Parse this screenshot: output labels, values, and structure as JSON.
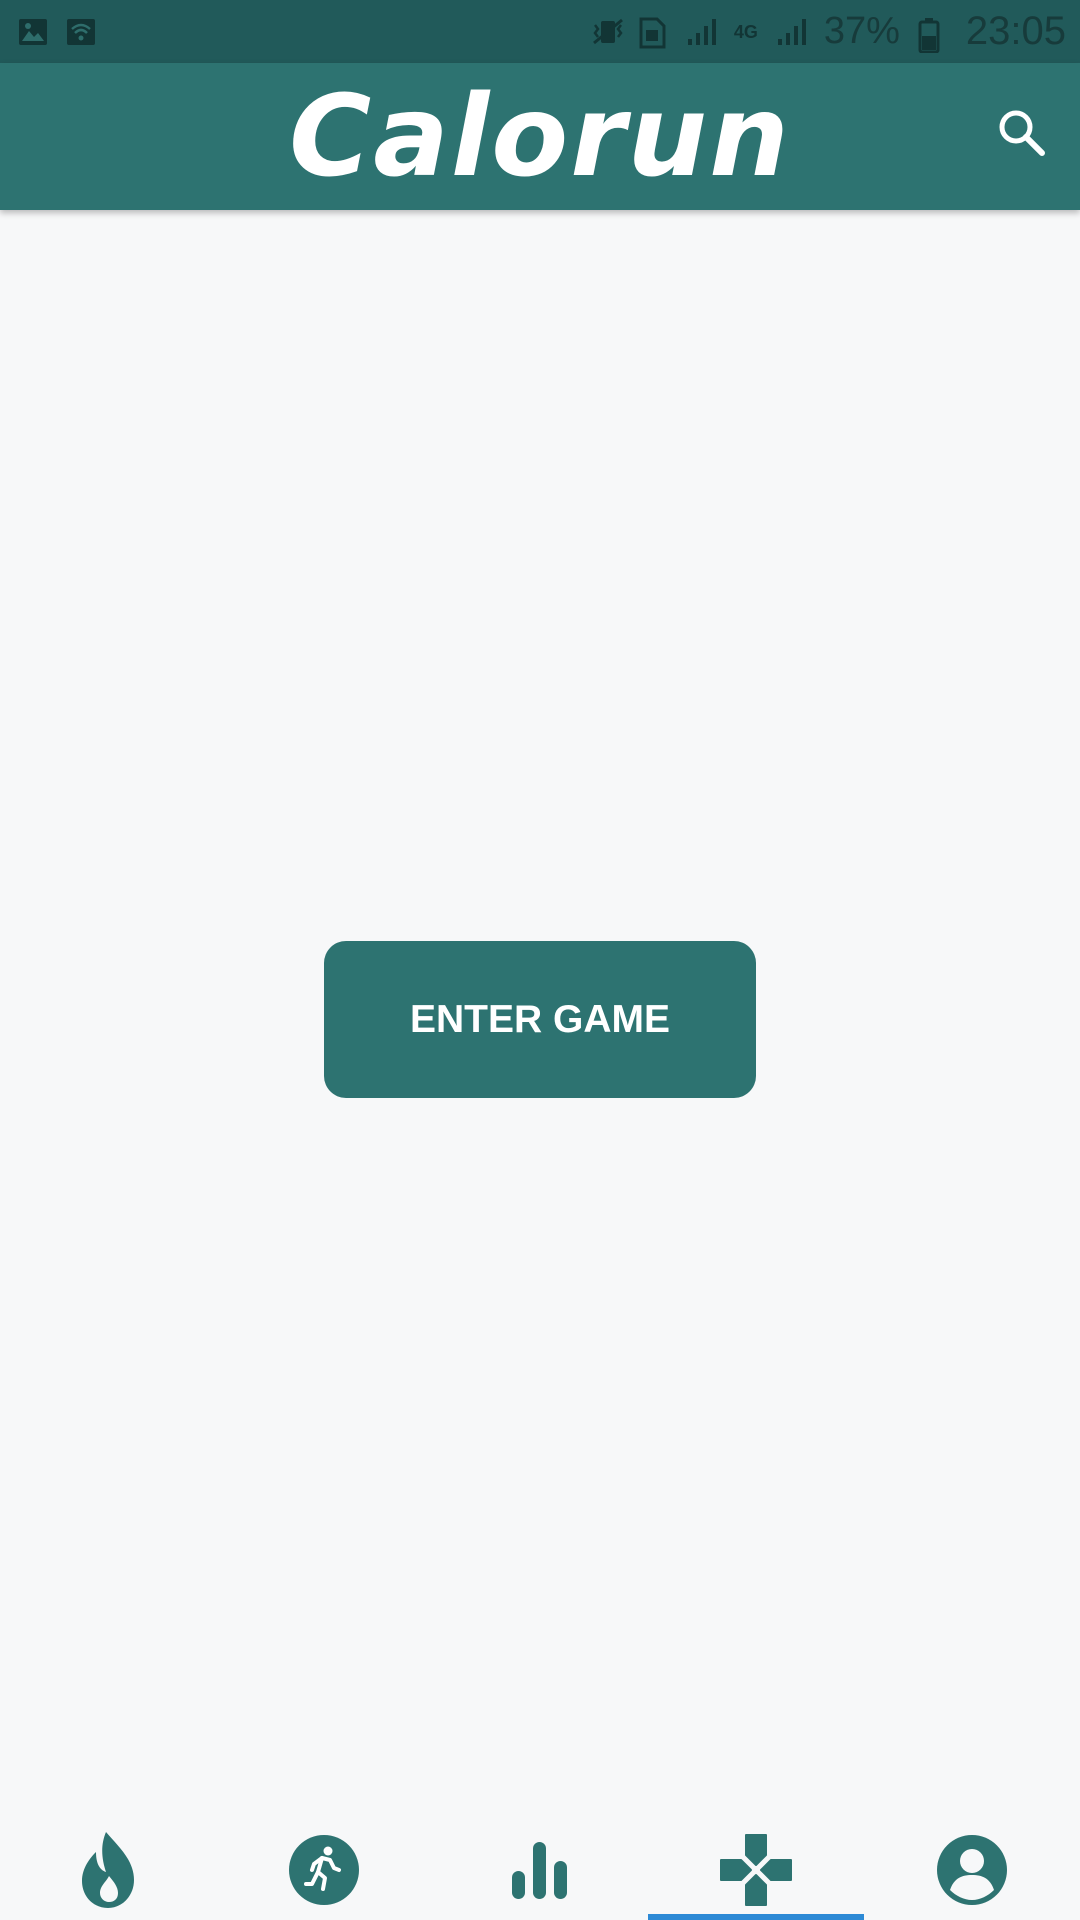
{
  "status_bar": {
    "battery": "37%",
    "time": "23:05",
    "network": "4G",
    "icons": [
      "image-icon",
      "wifi-icon",
      "vibrate-mute-icon",
      "sim-icon",
      "signal-icon",
      "signal-4g-icon",
      "signal-icon",
      "battery-icon"
    ]
  },
  "app_bar": {
    "title": "Calorun",
    "search_icon": "search-icon"
  },
  "main": {
    "enter_button_label": "ENTER GAME"
  },
  "bottom_nav": {
    "items": [
      {
        "icon": "flame-icon"
      },
      {
        "icon": "runner-icon"
      },
      {
        "icon": "bar-chart-icon"
      },
      {
        "icon": "gamepad-icon",
        "selected": true
      },
      {
        "icon": "profile-icon"
      }
    ]
  },
  "colors": {
    "primary": "#2d7371",
    "status_bar": "#215a5a",
    "background": "#f7f8f9",
    "indicator": "#2d8ad6"
  }
}
